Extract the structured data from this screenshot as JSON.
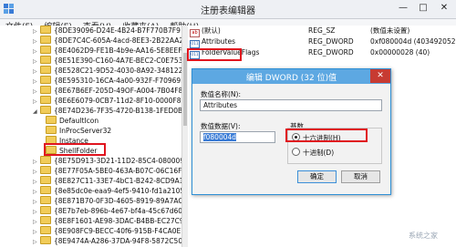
{
  "window": {
    "title": "注册表编辑器",
    "minimize": "—",
    "maximize": "□",
    "close": "✕",
    "app_icon": "registry-editor-icon"
  },
  "menu": [
    "文件(F)",
    "编辑(E)",
    "查看(V)",
    "收藏夹(A)",
    "帮助(H)"
  ],
  "tree": {
    "items": [
      {
        "label": "{8DE39096-D24E-4B24-B7F770B7F9",
        "level": 0
      },
      {
        "label": "{8DE7C4C-605A-4acd-8EE3-2B22AA2D3",
        "level": 0
      },
      {
        "label": "{8E4062D9-FE1B-4b9e-AA16-5E8EEF68F4",
        "level": 0
      },
      {
        "label": "{8E51E390-C160-4A7E-BEC2-C0E753AD171",
        "level": 0
      },
      {
        "label": "{8E528C21-9D52-4030-8A92-3481227ADDE",
        "level": 0
      },
      {
        "label": "{8E595310-16CA-4a00-932F-F70969F990C0",
        "level": 0
      },
      {
        "label": "{8E67B6EF-205D-49OF-A004-7B04F8F65B62",
        "level": 0
      },
      {
        "label": "{8E6E6079-0CB7-11d2-8F10-0000F87ABD16",
        "level": 0
      },
      {
        "label": "{8E74D236-7F35-4720-B138-1FED0B85EA75",
        "level": 0
      },
      {
        "label": "DefaultIcon",
        "level": 1
      },
      {
        "label": "InProcServer32",
        "level": 1
      },
      {
        "label": "Instance",
        "level": 1
      },
      {
        "label": "ShellFolder",
        "level": 1
      },
      {
        "label": "{8E75D913-3D21-11D2-85C4-080009A0C62",
        "level": 0
      },
      {
        "label": "{8E77F05A-5BE0-463A-B07C-06C16F5252",
        "level": 0
      },
      {
        "label": "{8E827C11-33E7-4bC1-B242-8CD9A1C2B3",
        "level": 0
      },
      {
        "label": "{8e85dc0e-eaa9-4ef5-9410-fd1a2105ceb5}",
        "level": 0
      },
      {
        "label": "{8E871B70-0F3D-4605-8919-89A7ACBA199",
        "level": 0
      },
      {
        "label": "{8E7b7eb-896b-4e67-bf4a-45c67d60ac3a}",
        "level": 0
      },
      {
        "label": "{8E8F1601-AE98-3DAC-B4BB-EC27C95A481",
        "level": 0
      },
      {
        "label": "{8E908FC9-BECC-40f6-915B-F4CA0E70D03",
        "level": 0
      },
      {
        "label": "{8E9474A-A286-37DA-94F8-5872C500FB0",
        "level": 0
      }
    ],
    "selected_label": "ShellFolder"
  },
  "list": {
    "columns": [
      "名称",
      "类型",
      "数据"
    ],
    "rows": [
      {
        "name": "(默认)",
        "type": "REG_SZ",
        "data": "(数值未设置)",
        "icon": "string-value-icon"
      },
      {
        "name": "Attributes",
        "type": "REG_DWORD",
        "data": "0xf080004d (4034920525)",
        "icon": "binary-value-icon"
      },
      {
        "name": "FolderValueFlags",
        "type": "REG_DWORD",
        "data": "0x00000028 (40)",
        "icon": "binary-value-icon"
      }
    ]
  },
  "dialog": {
    "title": "编辑 DWORD (32 位)值",
    "close": "✕",
    "value_name_label": "数值名称(N):",
    "value_name": "Attributes",
    "value_data_label": "数值数据(V):",
    "value_data": "f080004d",
    "base_label": "基数",
    "hex_label": "十六进制(H)",
    "dec_label": "十进制(D)",
    "selected_base": "hex",
    "ok_label": "确定",
    "cancel_label": "取消"
  },
  "highlight_color": "#e0141e",
  "watermark": "系统之家"
}
